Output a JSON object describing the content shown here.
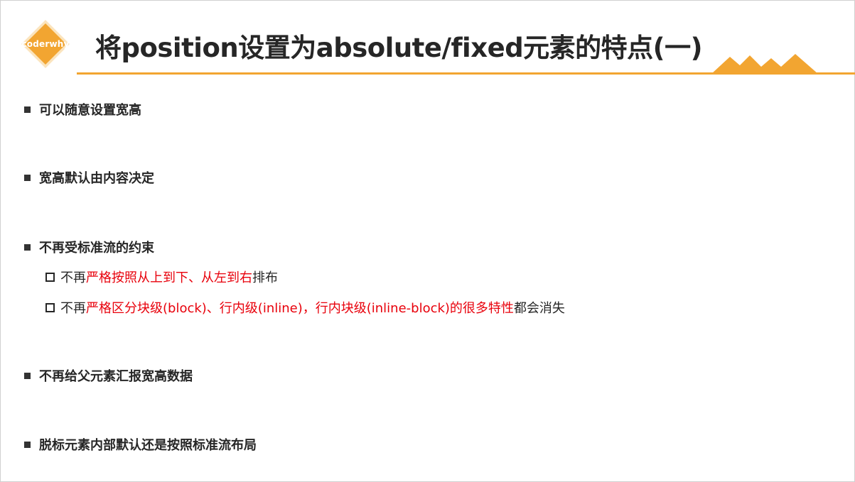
{
  "brand": {
    "logo_text": "coderwhy",
    "accent_color": "#f2a531",
    "highlight_color": "#e8000b"
  },
  "slide": {
    "title": "将position设置为absolute/fixed元素的特点(一)"
  },
  "bullets": [
    "可以随意设置宽高",
    "宽高默认由内容决定",
    "不再受标准流的约束",
    "不再给父元素汇报宽高数据",
    "脱标元素内部默认还是按照标准流布局"
  ],
  "sub_points": [
    {
      "prefix": "不再",
      "highlight": "严格按照从上到下、从左到右",
      "suffix": "排布"
    },
    {
      "prefix": "不再",
      "highlight": "严格区分块级(block)、行内级(inline)，行内块级(inline-block)的很多特性",
      "suffix": "都会消失"
    }
  ]
}
